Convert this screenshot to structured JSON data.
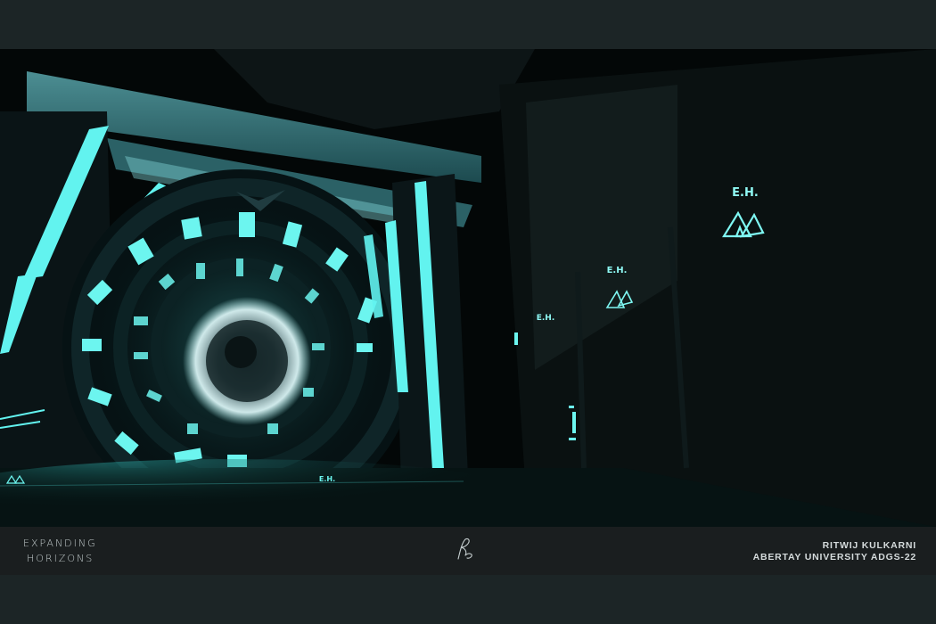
{
  "scene": {
    "description_labels": {
      "wall_logo_big": "E.H.",
      "wall_logo_mid": "E.H.",
      "wall_logo_small": "E.H.",
      "floor_sign": "E.H."
    },
    "glow_color": "#5ff6f0",
    "background_color": "#030707"
  },
  "footer": {
    "logo_line_1": "EXPANDING",
    "logo_line_2": "HORIZONS",
    "credit_name": "RITWIJ KULKARNI",
    "credit_org": "ABERTAY UNIVERSITY ADGS-22"
  }
}
